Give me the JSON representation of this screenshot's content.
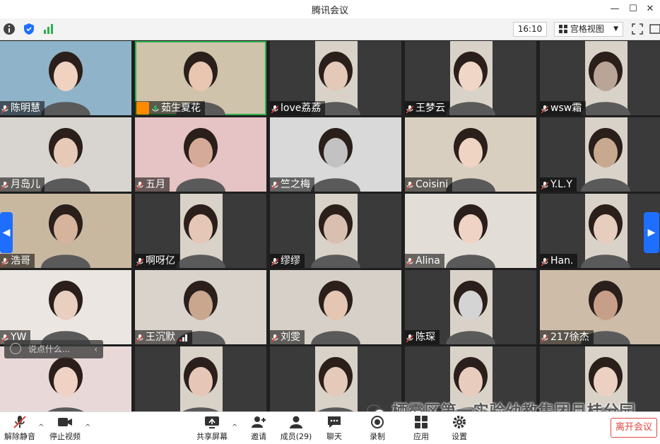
{
  "window": {
    "title": "腾讯会议"
  },
  "toolbar": {
    "time": "16:10",
    "view_label": "宫格视图"
  },
  "participants": [
    {
      "name": "陈明慧",
      "bg": "#8fb3c9",
      "face": "#f0d2c0",
      "muted": true,
      "speaking": false
    },
    {
      "name": "茹生夏花",
      "bg": "#cfc3ab",
      "face": "#e8c6b0",
      "muted": false,
      "speaking": true,
      "host": true
    },
    {
      "name": "love荔荔",
      "bg": "#3a3a3a",
      "face": "#e5c9b8",
      "muted": true,
      "speaking": false
    },
    {
      "name": "王梦云",
      "bg": "#3a3a3a",
      "face": "#efd6c6",
      "muted": true,
      "speaking": false
    },
    {
      "name": "wsw霜",
      "bg": "#3a3a3a",
      "face": "#b9a597",
      "muted": true,
      "speaking": false
    },
    {
      "name": "月岛儿",
      "bg": "#d8d4cf",
      "face": "#e6c9b6",
      "muted": true,
      "speaking": false
    },
    {
      "name": "五月",
      "bg": "#e6c3c4",
      "face": "#d6aa98",
      "muted": true,
      "speaking": false
    },
    {
      "name": "竺之梅",
      "bg": "#d9d9d9",
      "face": "#c2c2c2",
      "muted": true,
      "speaking": false
    },
    {
      "name": "Coisini",
      "bg": "#d8cfc0",
      "face": "#efd4c4",
      "muted": true,
      "speaking": false
    },
    {
      "name": "Y.L.Y",
      "bg": "#3a3a3a",
      "face": "#c8a88f",
      "muted": true,
      "speaking": false
    },
    {
      "name": "浩哥",
      "bg": "#c9b8a0",
      "face": "#d6b39c",
      "muted": true,
      "speaking": false
    },
    {
      "name": "啊呀亿",
      "bg": "#3a3a3a",
      "face": "#e4c7b7",
      "muted": true,
      "speaking": false
    },
    {
      "name": "缪缪",
      "bg": "#3a3a3a",
      "face": "#d9bfaf",
      "muted": true,
      "speaking": false
    },
    {
      "name": "Alina",
      "bg": "#e3ddd8",
      "face": "#efd3c5",
      "muted": true,
      "speaking": false
    },
    {
      "name": "Han.",
      "bg": "#3a3a3a",
      "face": "#e7cdbd",
      "muted": true,
      "speaking": false
    },
    {
      "name": "YW",
      "bg": "#ece6e2",
      "face": "#e9cfc0",
      "muted": true,
      "speaking": false
    },
    {
      "name": "王沉默",
      "bg": "#d9d3cc",
      "face": "#c9a68e",
      "muted": true,
      "speaking": false,
      "signal": true
    },
    {
      "name": "刘雯",
      "bg": "#d6d0c8",
      "face": "#e4c6b3",
      "muted": true,
      "speaking": false
    },
    {
      "name": "陈琛",
      "bg": "#3a3a3a",
      "face": "#d4d4d4",
      "muted": true,
      "speaking": false
    },
    {
      "name": "217徐杰",
      "bg": "#cdbca8",
      "face": "#c79f88",
      "muted": true,
      "speaking": false
    },
    {
      "name": "",
      "bg": "#e8d9d8",
      "face": "#efd2c3",
      "muted": false,
      "speaking": false
    },
    {
      "name": "",
      "bg": "#3a3a3a",
      "face": "#e6c7b7",
      "muted": false,
      "speaking": false
    },
    {
      "name": "",
      "bg": "#3a3a3a",
      "face": "#e6cab9",
      "muted": false,
      "speaking": false
    },
    {
      "name": "",
      "bg": "#3a3a3a",
      "face": "#e8ccbd",
      "muted": false,
      "speaking": false
    },
    {
      "name": "",
      "bg": "#3a3a3a",
      "face": "#ecd1c2",
      "muted": false,
      "speaking": false
    }
  ],
  "chat": {
    "placeholder": "说点什么..."
  },
  "bottombar": {
    "unmute": "解除静音",
    "stop_video": "停止视频",
    "share_screen": "共享屏幕",
    "invite": "邀请",
    "members": "成员(29)",
    "chat": "聊天",
    "record": "录制",
    "apps": "应用",
    "settings": "设置",
    "leave": "离开会议"
  },
  "watermark": {
    "text": "栖霞区第一实验幼教集团月桂分园"
  },
  "colors": {
    "accent": "#1e6fff",
    "leave": "#e0463b",
    "speaking": "#2bb24c"
  }
}
